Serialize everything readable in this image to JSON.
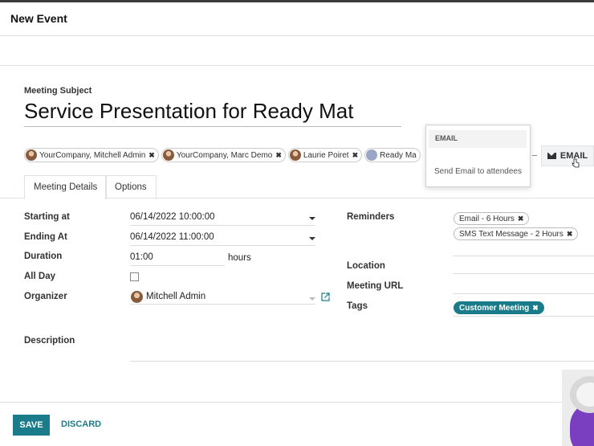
{
  "dialog": {
    "title": "New Event"
  },
  "subject": {
    "label": "Meeting Subject",
    "value": "Service Presentation for Ready Mat"
  },
  "attendees": [
    {
      "name": "YourCompany, Mitchell Admin"
    },
    {
      "name": "YourCompany, Marc Demo"
    },
    {
      "name": "Laurie Poiret"
    },
    {
      "name": "Ready Ma"
    }
  ],
  "email_button": {
    "label": "EMAIL",
    "icon": "envelope-icon"
  },
  "email_dropdown": {
    "header": "EMAIL",
    "item": "Send Email to attendees"
  },
  "tabs": [
    {
      "label": "Meeting Details",
      "active": true
    },
    {
      "label": "Options",
      "active": false
    }
  ],
  "form": {
    "starting_at": {
      "label": "Starting at",
      "value": "06/14/2022 10:00:00"
    },
    "ending_at": {
      "label": "Ending At",
      "value": "06/14/2022 11:00:00"
    },
    "duration": {
      "label": "Duration",
      "value": "01:00",
      "unit": "hours"
    },
    "all_day": {
      "label": "All Day",
      "checked": false
    },
    "organizer": {
      "label": "Organizer",
      "value": "Mitchell Admin"
    },
    "description": {
      "label": "Description"
    },
    "reminders": {
      "label": "Reminders",
      "items": [
        "Email - 6 Hours",
        "SMS Text Message - 2 Hours"
      ]
    },
    "location": {
      "label": "Location"
    },
    "meeting_url": {
      "label": "Meeting URL"
    },
    "tags": {
      "label": "Tags",
      "items": [
        "Customer Meeting"
      ]
    }
  },
  "footer": {
    "save": "SAVE",
    "discard": "DISCARD"
  },
  "colors": {
    "accent": "#1a7c8a",
    "tag_teal": "#1a7c8a"
  }
}
